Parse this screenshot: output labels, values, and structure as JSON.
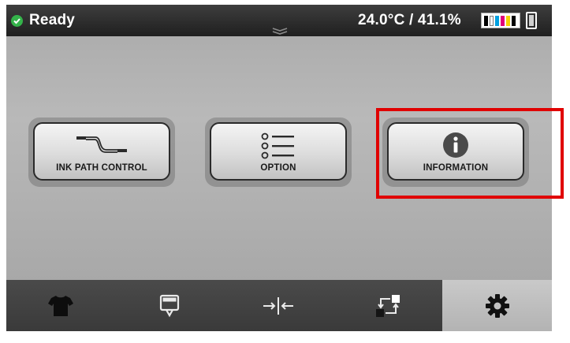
{
  "status_bar": {
    "status_text": "Ready",
    "status_icon": "check-circle-icon",
    "status_color": "#34b34a",
    "environment": "24.0°C / 41.1%",
    "ink_icon": "ink-levels-icon",
    "waste_icon": "waste-tank-icon",
    "ink_colors": [
      "#000000",
      "#ffffff",
      "#00a0e0",
      "#e0007a",
      "#f5d200"
    ]
  },
  "menu_buttons": [
    {
      "label": "INK PATH CONTROL",
      "icon": "ink-path-icon"
    },
    {
      "label": "OPTION",
      "icon": "option-list-icon"
    },
    {
      "label": "INFORMATION",
      "icon": "info-icon"
    }
  ],
  "bottom_nav": [
    {
      "icon": "tshirt-icon"
    },
    {
      "icon": "platen-icon"
    },
    {
      "icon": "adjust-gap-icon"
    },
    {
      "icon": "transfer-icon"
    },
    {
      "icon": "gear-icon",
      "selected": true
    }
  ],
  "highlight": {
    "target": "INFORMATION",
    "color": "#e00000"
  }
}
